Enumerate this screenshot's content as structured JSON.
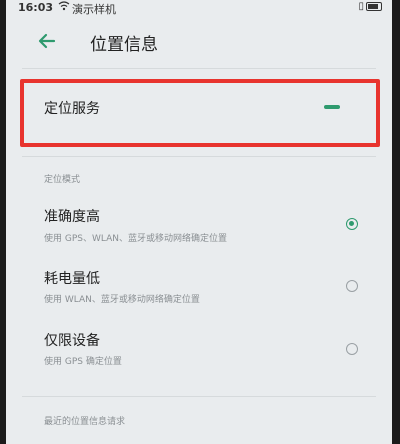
{
  "status_bar": {
    "time": "16:03",
    "carrier": "演示样机",
    "wifi_icon": "wifi-icon",
    "battery_icon": "battery-icon"
  },
  "header": {
    "title": "位置信息",
    "back_icon": "back-arrow-icon"
  },
  "location_service": {
    "label": "定位服务"
  },
  "mode_section": {
    "header": "定位模式",
    "options": [
      {
        "title": "准确度高",
        "desc": "使用 GPS、WLAN、蓝牙或移动网络确定位置",
        "selected": true
      },
      {
        "title": "耗电量低",
        "desc": "使用 WLAN、蓝牙或移动网络确定位置",
        "selected": false
      },
      {
        "title": "仅限设备",
        "desc": "使用 GPS 确定位置",
        "selected": false
      }
    ]
  },
  "recent_section": {
    "header": "最近的位置信息请求"
  },
  "colors": {
    "accent": "#2e9a6e",
    "highlight_border": "#e8342e",
    "background": "#e9ecee"
  }
}
